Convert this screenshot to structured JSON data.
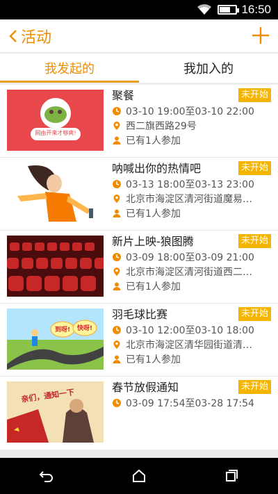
{
  "status": {
    "time": "16:50",
    "battery_text": ""
  },
  "header": {
    "back_label": "活动"
  },
  "tabs": [
    {
      "label": "我发起的",
      "active": true
    },
    {
      "label": "我加入的",
      "active": false
    }
  ],
  "events": [
    {
      "title": "聚餐",
      "status": "未开始",
      "time": "03-10 19:00至03-10 22:00",
      "location": "西二旗西路29号",
      "participants": "已有1人参加",
      "thumb_text": "网由开来才够爽!"
    },
    {
      "title": "呐喊出你的热情吧",
      "status": "未开始",
      "time": "03-13 18:00至03-13 23:00",
      "location": "北京市海淀区清河街道魔易…",
      "participants": "已有1人参加"
    },
    {
      "title": "新片上映-狼图腾",
      "status": "未开始",
      "time": "03-09 18:00至03-09 21:00",
      "location": "北京市海淀区清河街道西二…",
      "participants": "已有1人参加"
    },
    {
      "title": "羽毛球比赛",
      "status": "未开始",
      "time": "03-10 12:00至03-10 18:00",
      "location": "北京市海淀区清华园街道清…",
      "participants": "已有1人参加",
      "thumb_text_1": "到呀!",
      "thumb_text_2": "快呀!"
    },
    {
      "title": "春节放假通知",
      "status": "未开始",
      "time": "03-09 17:54至03-28 17:54",
      "location": "",
      "participants": "",
      "thumb_text": "亲们，通知一下"
    }
  ],
  "colors": {
    "accent": "#f08c00",
    "badge": "#f5b400"
  },
  "icons": {
    "back": "chevron-left-icon",
    "add": "plus-icon",
    "time": "clock-icon",
    "location": "location-pin-icon",
    "people": "person-icon"
  }
}
